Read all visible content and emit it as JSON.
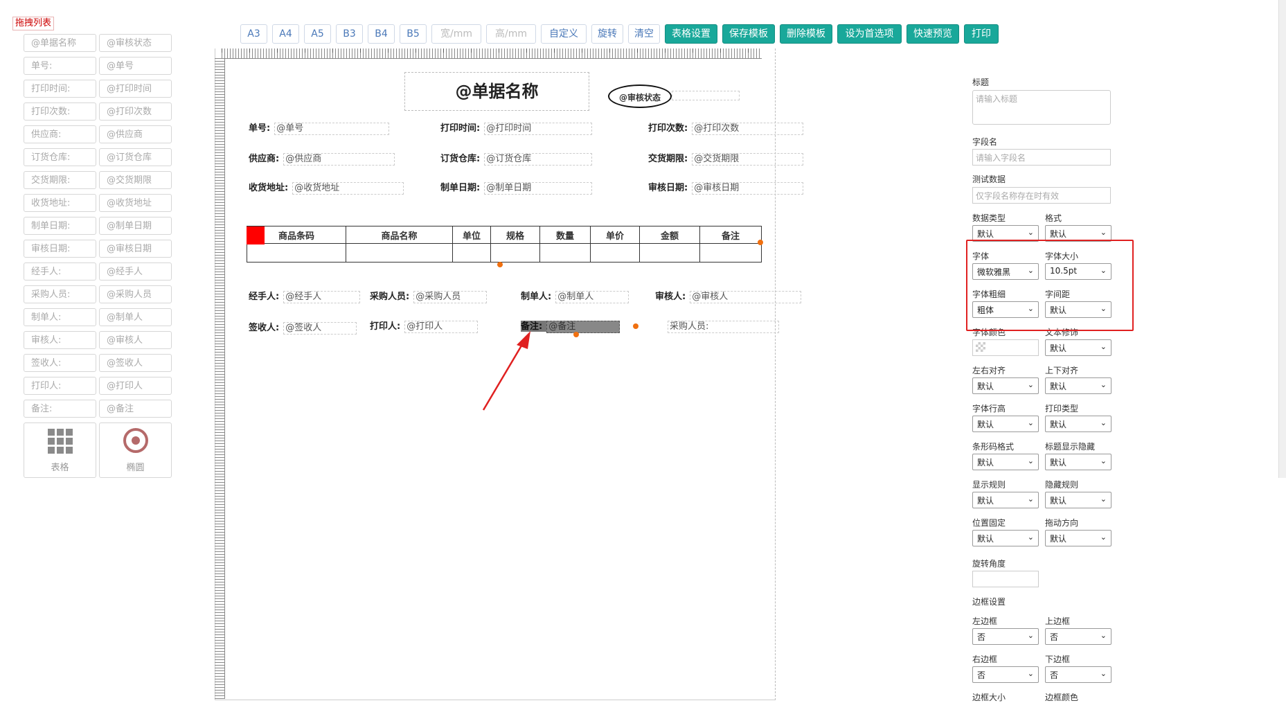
{
  "left_panel": {
    "title": "拖拽列表",
    "items": [
      [
        "@单据名称",
        "@审核状态"
      ],
      [
        "单号:",
        "@单号"
      ],
      [
        "打印时间:",
        "@打印时间"
      ],
      [
        "打印次数:",
        "@打印次数"
      ],
      [
        "供应商:",
        "@供应商"
      ],
      [
        "订货仓库:",
        "@订货仓库"
      ],
      [
        "交货期限:",
        "@交货期限"
      ],
      [
        "收货地址:",
        "@收货地址"
      ],
      [
        "制单日期:",
        "@制单日期"
      ],
      [
        "审核日期:",
        "@审核日期"
      ],
      [
        "经手人:",
        "@经手人"
      ],
      [
        "采购人员:",
        "@采购人员"
      ],
      [
        "制单人:",
        "@制单人"
      ],
      [
        "审核人:",
        "@审核人"
      ],
      [
        "签收人:",
        "@签收人"
      ],
      [
        "打印人:",
        "@打印人"
      ],
      [
        "备注:",
        "@备注"
      ]
    ],
    "tiles": [
      {
        "label": "表格",
        "icon": "grid-icon"
      },
      {
        "label": "椭圆",
        "icon": "target-icon"
      }
    ]
  },
  "toolbar": {
    "buttons": [
      {
        "label": "A3",
        "style": "plain"
      },
      {
        "label": "A4",
        "style": "plain"
      },
      {
        "label": "A5",
        "style": "plain"
      },
      {
        "label": "B3",
        "style": "plain"
      },
      {
        "label": "B4",
        "style": "plain"
      },
      {
        "label": "B5",
        "style": "plain"
      },
      {
        "label": "宽/mm",
        "style": "disabled"
      },
      {
        "label": "高/mm",
        "style": "disabled"
      },
      {
        "label": "自定义",
        "style": "plain"
      },
      {
        "label": "旋转",
        "style": "plain"
      },
      {
        "label": "清空",
        "style": "plain"
      },
      {
        "label": "表格设置",
        "style": "teal"
      },
      {
        "label": "保存模板",
        "style": "teal"
      },
      {
        "label": "删除模板",
        "style": "teal"
      },
      {
        "label": "设为首选项",
        "style": "teal"
      },
      {
        "label": "快速预览",
        "style": "teal"
      },
      {
        "label": "打印",
        "style": "teal"
      }
    ]
  },
  "canvas": {
    "doc_title": "@单据名称",
    "status": "@审核状态",
    "fields": {
      "danhao": {
        "label": "单号:",
        "value": "@单号"
      },
      "print_time": {
        "label": "打印时间:",
        "value": "@打印时间"
      },
      "print_count": {
        "label": "打印次数:",
        "value": "@打印次数"
      },
      "supplier": {
        "label": "供应商:",
        "value": "@供应商"
      },
      "warehouse": {
        "label": "订货仓库:",
        "value": "@订货仓库"
      },
      "deadline": {
        "label": "交货期限:",
        "value": "@交货期限"
      },
      "address": {
        "label": "收货地址:",
        "value": "@收货地址"
      },
      "make_date": {
        "label": "制单日期:",
        "value": "@制单日期"
      },
      "audit_date": {
        "label": "审核日期:",
        "value": "@审核日期"
      },
      "handler": {
        "label": "经手人:",
        "value": "@经手人"
      },
      "buyer": {
        "label": "采购人员:",
        "value": "@采购人员"
      },
      "maker": {
        "label": "制单人:",
        "value": "@制单人"
      },
      "auditor": {
        "label": "审核人:",
        "value": "@审核人"
      },
      "receiver": {
        "label": "签收人:",
        "value": "@签收人"
      },
      "printer": {
        "label": "打印人:",
        "value": "@打印人"
      },
      "remark": {
        "label": "备注:",
        "value": "@备注"
      },
      "buyer2": {
        "value": "采购人员:"
      }
    },
    "table_headers": [
      "商品条码",
      "商品名称",
      "单位",
      "规格",
      "数量",
      "单价",
      "金额",
      "备注"
    ]
  },
  "props": {
    "title_label": "标题",
    "title_placeholder": "请输入标题",
    "field_label": "字段名",
    "field_placeholder": "请输入字段名",
    "test_label": "测试数据",
    "test_placeholder": "仅字段名称存在时有效",
    "rows": [
      [
        {
          "label": "数据类型",
          "value": "默认"
        },
        {
          "label": "格式",
          "value": "默认"
        }
      ],
      [
        {
          "label": "字体",
          "value": "微软雅黑"
        },
        {
          "label": "字体大小",
          "value": "10.5pt"
        }
      ],
      [
        {
          "label": "字体粗细",
          "value": "粗体"
        },
        {
          "label": "字间距",
          "value": "默认"
        }
      ],
      [
        {
          "label": "字体颜色",
          "value": ""
        },
        {
          "label": "文本修饰",
          "value": "默认"
        }
      ],
      [
        {
          "label": "左右对齐",
          "value": "默认"
        },
        {
          "label": "上下对齐",
          "value": "默认"
        }
      ],
      [
        {
          "label": "字体行高",
          "value": "默认"
        },
        {
          "label": "打印类型",
          "value": "默认"
        }
      ],
      [
        {
          "label": "条形码格式",
          "value": "默认"
        },
        {
          "label": "标题显示隐藏",
          "value": "默认"
        }
      ],
      [
        {
          "label": "显示规则",
          "value": "默认"
        },
        {
          "label": "隐藏规则",
          "value": "默认"
        }
      ],
      [
        {
          "label": "位置固定",
          "value": "默认"
        },
        {
          "label": "拖动方向",
          "value": "默认"
        }
      ]
    ],
    "rotate_label": "旋转角度",
    "border_label": "边框设置",
    "border_rows": [
      [
        {
          "label": "左边框",
          "value": "否"
        },
        {
          "label": "上边框",
          "value": "否"
        }
      ],
      [
        {
          "label": "右边框",
          "value": "否"
        },
        {
          "label": "下边框",
          "value": "否"
        }
      ]
    ],
    "bottom_labels": [
      "边框大小",
      "边框颜色"
    ]
  },
  "colors": {
    "accent": "#19a89a",
    "highlight": "#e02020",
    "arrow": "#e02020",
    "handle": "#f07010"
  }
}
